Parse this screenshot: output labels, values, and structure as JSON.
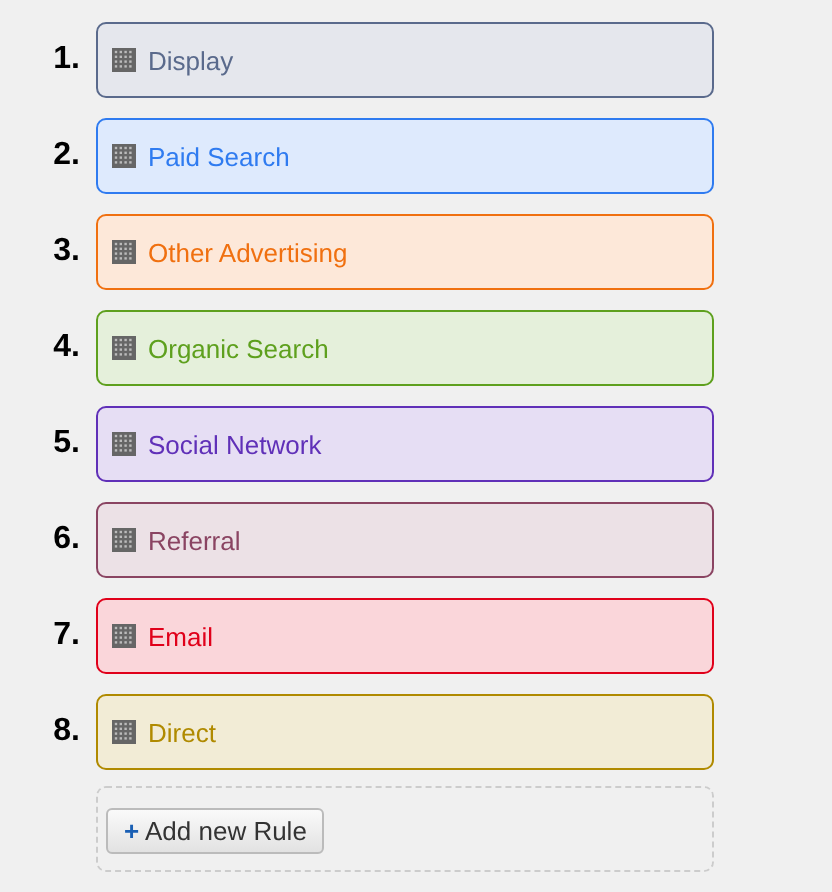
{
  "rules": [
    {
      "number": "1.",
      "label": "Display",
      "color": "#5a6a8c"
    },
    {
      "number": "2.",
      "label": "Paid Search",
      "color": "#2f7bf0"
    },
    {
      "number": "3.",
      "label": "Other Advertising",
      "color": "#f07010"
    },
    {
      "number": "4.",
      "label": "Organic Search",
      "color": "#5ea01e"
    },
    {
      "number": "5.",
      "label": "Social Network",
      "color": "#6030b8"
    },
    {
      "number": "6.",
      "label": "Referral",
      "color": "#8a4462"
    },
    {
      "number": "7.",
      "label": "Email",
      "color": "#e0001a"
    },
    {
      "number": "8.",
      "label": "Direct",
      "color": "#b08a00"
    }
  ],
  "add_button": {
    "icon": "+",
    "label": "Add new Rule"
  }
}
